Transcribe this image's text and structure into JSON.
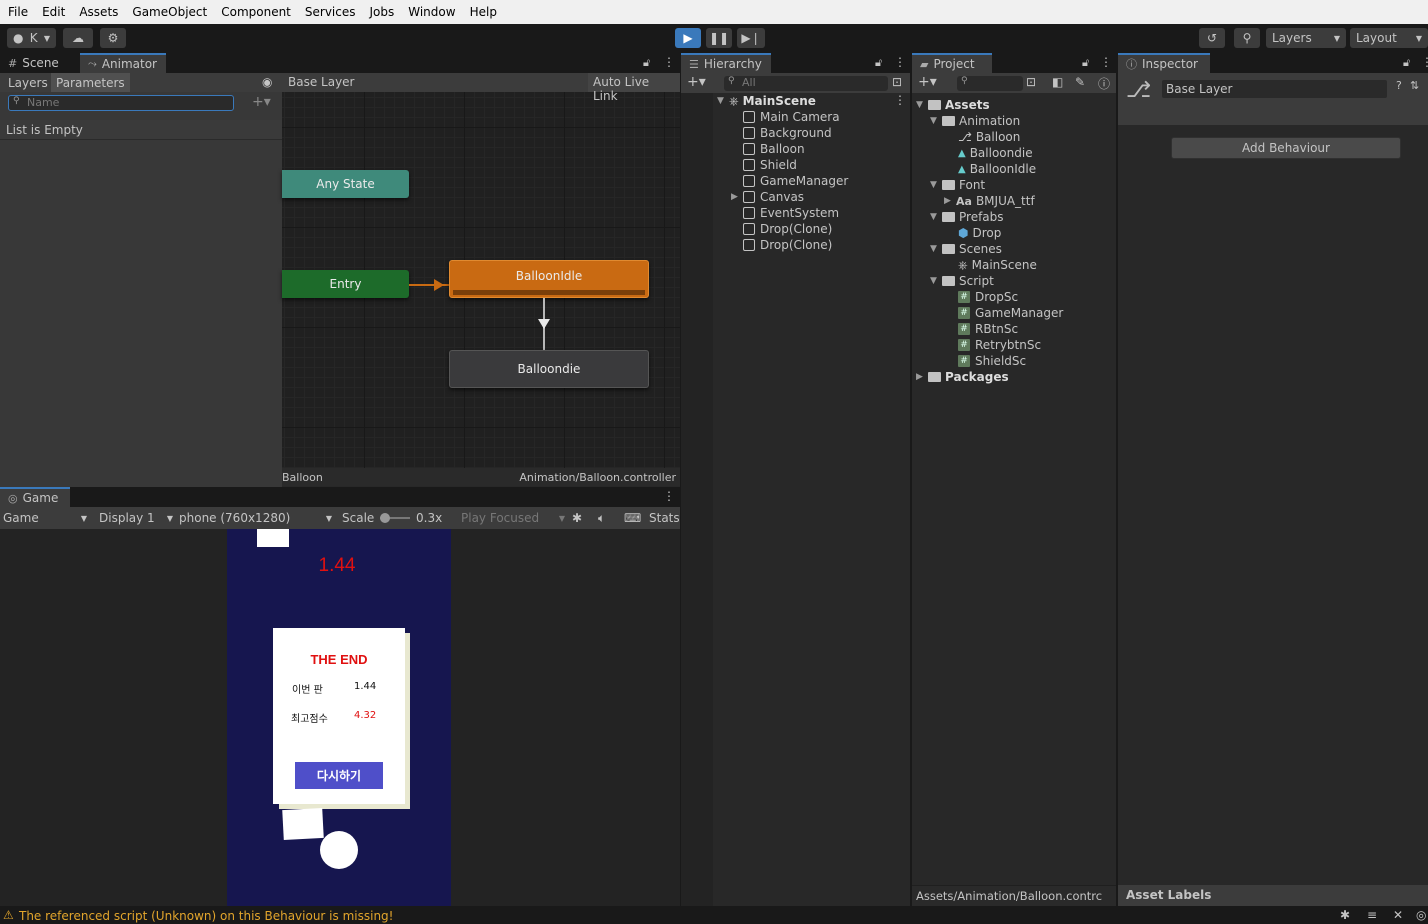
{
  "menu": [
    "File",
    "Edit",
    "Assets",
    "GameObject",
    "Component",
    "Services",
    "Jobs",
    "Window",
    "Help"
  ],
  "toolbar": {
    "account": "K",
    "layers": "Layers",
    "layout": "Layout"
  },
  "animator": {
    "tab_scene": "Scene",
    "tab_animator": "Animator",
    "subtab_layers": "Layers",
    "subtab_parameters": "Parameters",
    "search_placeholder": "Name",
    "empty_text": "List is Empty",
    "breadcrumb": "Base Layer",
    "auto_live_link": "Auto Live Link",
    "footer_left": "Balloon",
    "footer_right": "Animation/Balloon.controller",
    "nodes": {
      "any_state": "Any State",
      "entry": "Entry",
      "idle": "BalloonIdle",
      "die": "Balloondie"
    }
  },
  "hierarchy": {
    "tab": "Hierarchy",
    "search_placeholder": "All",
    "scene": "MainScene",
    "items": [
      "Main Camera",
      "Background",
      "Balloon",
      "Shield",
      "GameManager",
      "Canvas",
      "EventSystem",
      "Drop(Clone)",
      "Drop(Clone)"
    ]
  },
  "project": {
    "tab": "Project",
    "assets": "Assets",
    "animation": "Animation",
    "anim_items": [
      "Balloon",
      "Balloondie",
      "BalloonIdle"
    ],
    "font": "Font",
    "font_items": [
      "BMJUA_ttf"
    ],
    "font_prefix": "Aa",
    "prefabs": "Prefabs",
    "prefab_items": [
      "Drop"
    ],
    "scenes": "Scenes",
    "scene_items": [
      "MainScene"
    ],
    "script": "Script",
    "script_items": [
      "DropSc",
      "GameManager",
      "RBtnSc",
      "RetrybtnSc",
      "ShieldSc"
    ],
    "packages": "Packages",
    "footer_path": "Assets/Animation/Balloon.contrc"
  },
  "inspector": {
    "tab": "Inspector",
    "layer_name": "Base Layer",
    "add_behaviour": "Add Behaviour",
    "asset_labels": "Asset Labels"
  },
  "game": {
    "tab": "Game",
    "mode": "Game",
    "display": "Display 1",
    "resolution": "phone (760x1280)",
    "scale_label": "Scale",
    "scale_value": "0.3x",
    "play_focused": "Play Focused",
    "stats": "Stats",
    "score": "1.44",
    "end_title": "THE END",
    "this_round_label": "이번 판",
    "this_round_value": "1.44",
    "best_label": "최고점수",
    "best_value": "4.32",
    "retry": "다시하기"
  },
  "status": {
    "warning": "The referenced script (Unknown) on this Behaviour is missing!"
  },
  "colors": {
    "accent": "#3a79bb",
    "idle_node": "#c96a12",
    "entry_node": "#1d6b2a",
    "any_state_node": "#3f8a7b",
    "game_bg": "#16164f",
    "score_red": "#e01010",
    "retry_btn": "#4f4fc9",
    "warning": "#e2a52c"
  }
}
